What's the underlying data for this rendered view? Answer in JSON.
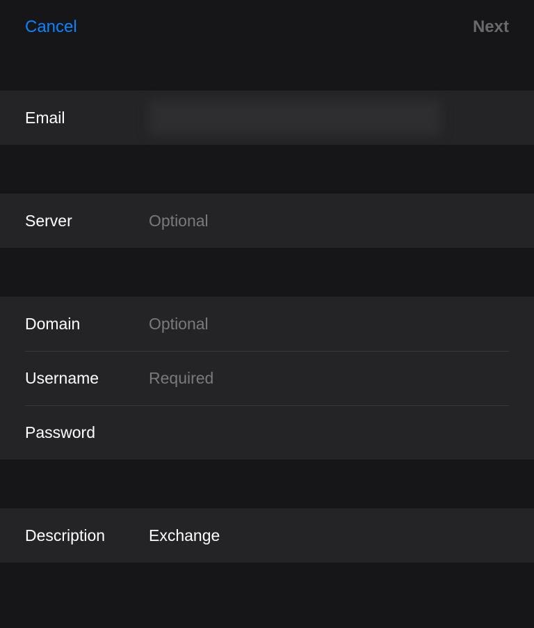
{
  "nav": {
    "cancel": "Cancel",
    "next": "Next"
  },
  "fields": {
    "email": {
      "label": "Email",
      "value": "",
      "placeholder": ""
    },
    "server": {
      "label": "Server",
      "value": "",
      "placeholder": "Optional"
    },
    "domain": {
      "label": "Domain",
      "value": "",
      "placeholder": "Optional"
    },
    "username": {
      "label": "Username",
      "value": "",
      "placeholder": "Required"
    },
    "password": {
      "label": "Password",
      "value": "",
      "placeholder": ""
    },
    "description": {
      "label": "Description",
      "value": "Exchange",
      "placeholder": ""
    }
  }
}
